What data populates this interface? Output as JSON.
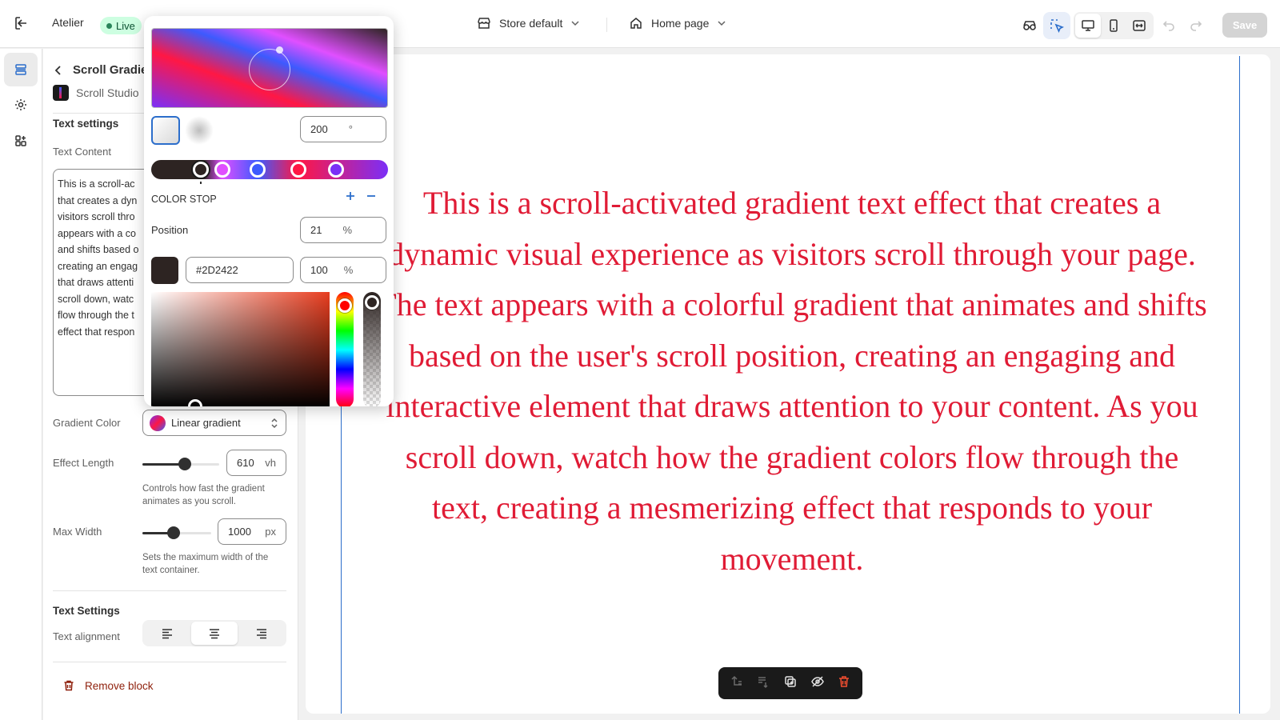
{
  "app": {
    "name": "Atelier",
    "status": "Live"
  },
  "topbar": {
    "store_selector": "Store default",
    "page_selector": "Home page",
    "save_label": "Save"
  },
  "sidebar": {
    "title": "Scroll Gradie",
    "app_name": "Scroll Studio",
    "section_text_settings": "Text settings",
    "text_content_label": "Text Content",
    "text_content_lines": [
      "This is a scroll-ac",
      "that creates a dyn",
      "visitors scroll thro",
      "appears with a co",
      "and shifts based o",
      "creating an engag",
      "that draws attenti",
      "scroll down, watc",
      "flow through the t",
      "effect that respon"
    ],
    "gradient_color_label": "Gradient Color",
    "gradient_color_value": "Linear gradient",
    "effect_length_label": "Effect Length",
    "effect_length_value": "610",
    "effect_length_unit": "vh",
    "effect_length_level": 0.55,
    "effect_length_help_1": "Controls how fast the gradient",
    "effect_length_help_2": "animates as you scroll.",
    "max_width_label": "Max Width",
    "max_width_value": "1000",
    "max_width_unit": "px",
    "max_width_level": 0.45,
    "max_width_help_1": "Sets the maximum width of the",
    "max_width_help_2": "text container.",
    "section_text_settings_2": "Text Settings",
    "text_alignment_label": "Text alignment",
    "remove_block_label": "Remove block"
  },
  "preview": {
    "text": "This is a scroll-activated gradient text effect that creates a dynamic visual experience as visitors scroll through your page. The text appears with a colorful gradient that animates and shifts based on the user's scroll position, creating an engaging and interactive element that draws attention to your content. As you scroll down, watch how the gradient colors flow through the text, creating a mesmerizing effect that responds to your movement."
  },
  "popover": {
    "angle_value": "200",
    "angle_unit": "°",
    "color_stop_label": "COLOR STOP",
    "position_label": "Position",
    "position_value": "21",
    "position_unit": "%",
    "hex_value": "#2D2422",
    "opacity_value": "100",
    "opacity_unit": "%",
    "stops": [
      {
        "color": "#2d2422",
        "position": 21
      },
      {
        "color": "#e04fff",
        "position": 30
      },
      {
        "color": "#3d5afe",
        "position": 45
      },
      {
        "color": "#ff1744",
        "position": 62
      },
      {
        "color": "#7b2ff7",
        "position": 78
      }
    ]
  },
  "colors": {
    "accent": "#2c6ecb",
    "text_red": "#e01b35",
    "danger": "#8e1f0b"
  }
}
